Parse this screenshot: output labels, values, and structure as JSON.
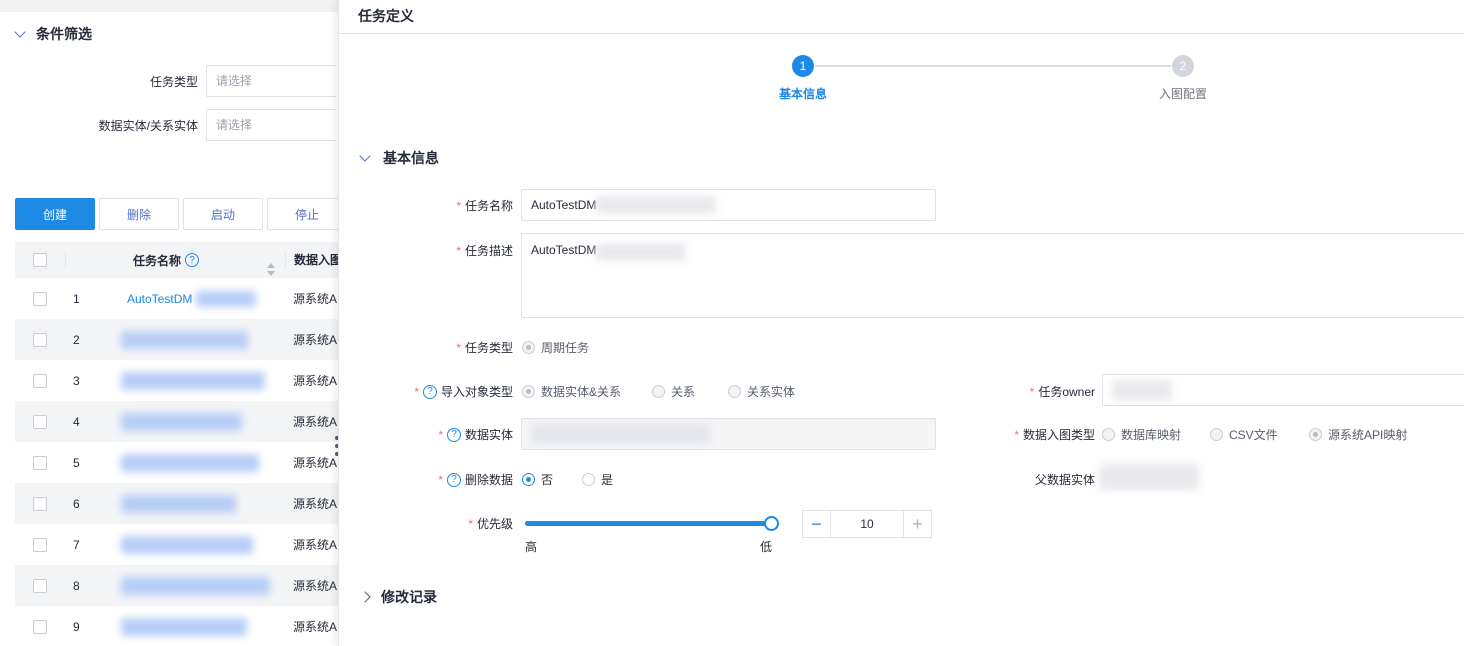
{
  "filter": {
    "title": "条件筛选",
    "task_type_label": "任务类型",
    "task_type_placeholder": "请选择",
    "entity_label": "数据实体/关系实体",
    "entity_placeholder": "请选择"
  },
  "toolbar": {
    "create": "创建",
    "delete": "删除",
    "start": "启动",
    "stop": "停止"
  },
  "table": {
    "headers": {
      "name": "任务名称",
      "source": "数据入图"
    },
    "rows": [
      {
        "index": "1",
        "name": "AutoTestDM",
        "source": "源系统A"
      },
      {
        "index": "2",
        "name": "",
        "source": "源系统A"
      },
      {
        "index": "3",
        "name": "",
        "source": "源系统A"
      },
      {
        "index": "4",
        "name": "",
        "source": "源系统A"
      },
      {
        "index": "5",
        "name": "",
        "source": "源系统A"
      },
      {
        "index": "6",
        "name": "",
        "source": "源系统A"
      },
      {
        "index": "7",
        "name": "",
        "source": "源系统A"
      },
      {
        "index": "8",
        "name": "",
        "source": "源系统A"
      },
      {
        "index": "9",
        "name": "",
        "source": "源系统A"
      }
    ]
  },
  "drawer": {
    "title": "任务定义",
    "steps": [
      {
        "number": "1",
        "label": "基本信息",
        "state": "active"
      },
      {
        "number": "2",
        "label": "入图配置",
        "state": "todo"
      }
    ],
    "basic_section": "基本信息",
    "history_section": "修改记录",
    "fields": {
      "task_name_label": "任务名称",
      "task_name_value": "AutoTestDM",
      "task_desc_label": "任务描述",
      "task_desc_value": "AutoTestDM",
      "task_type_label": "任务类型",
      "task_type_option": "周期任务",
      "import_type_label": "导入对象类型",
      "import_type_options": [
        "数据实体&关系",
        "关系",
        "关系实体"
      ],
      "owner_label": "任务owner",
      "data_entity_label": "数据实体",
      "ingest_type_label": "数据入图类型",
      "ingest_type_options": [
        "数据库映射",
        "CSV文件",
        "源系统API映射"
      ],
      "delete_data_label": "删除数据",
      "delete_data_options": [
        "否",
        "是"
      ],
      "parent_entity_label": "父数据实体",
      "priority_label": "优先级",
      "priority_high": "高",
      "priority_low": "低",
      "priority_value": "10",
      "priority_slider_fraction": 1.0
    }
  },
  "colors": {
    "primary": "#1e88e5",
    "required": "#f66f6a",
    "border": "#dfe1e6"
  }
}
